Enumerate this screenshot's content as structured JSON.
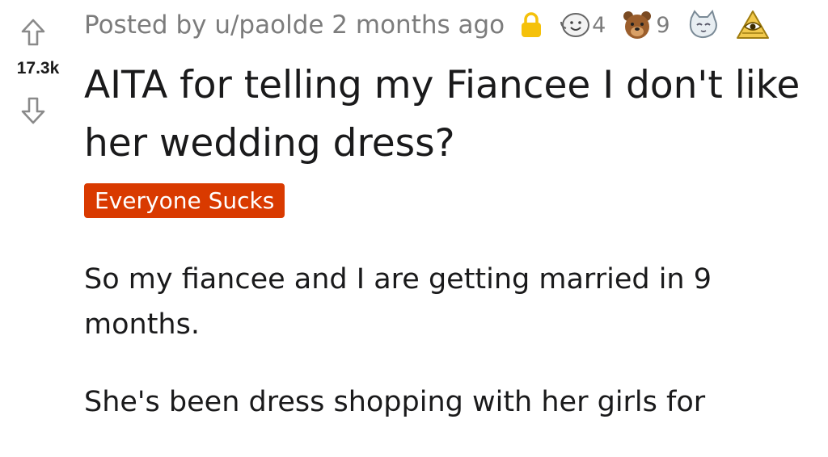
{
  "post": {
    "score": "17.3k",
    "posted_by": "Posted by u/paolde 2 months ago",
    "awards": [
      {
        "icon": "wholesome-award-icon",
        "count": "4"
      },
      {
        "icon": "bear-award-icon",
        "count": "9"
      },
      {
        "icon": "cat-award-icon",
        "count": ""
      },
      {
        "icon": "pyramid-eye-award-icon",
        "count": ""
      }
    ],
    "title": "AITA for telling my Fiancee I don't like her wedding dress?",
    "flair": "Everyone Sucks",
    "body": [
      "So my fiancee and I are getting married in 9 months.",
      "She's been dress shopping with her girls for"
    ]
  },
  "colors": {
    "flair_bg": "#d93a00",
    "meta_text": "#7c7c7c",
    "lock": "#f5c10a"
  }
}
